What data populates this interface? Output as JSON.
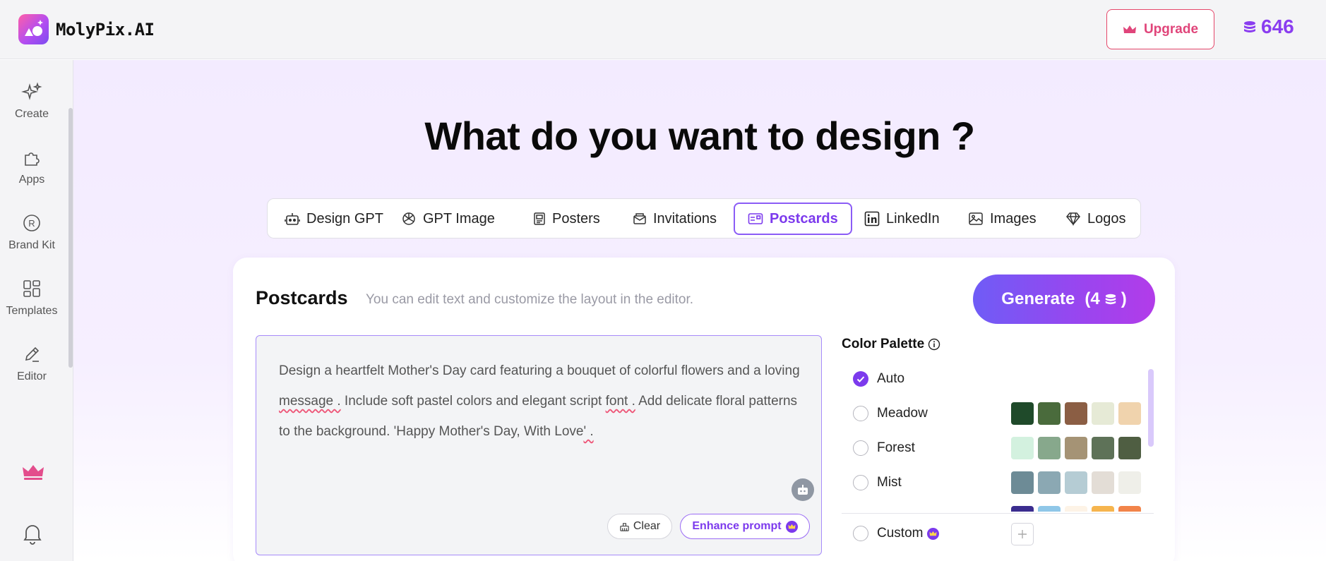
{
  "app": {
    "name": "MolyPix.AI"
  },
  "header": {
    "upgrade_label": "Upgrade",
    "credits": "646"
  },
  "sidebar": {
    "items": [
      {
        "label": "Create",
        "icon": "sparkles-icon"
      },
      {
        "label": "Apps",
        "icon": "puzzle-icon"
      },
      {
        "label": "Brand Kit",
        "icon": "registered-icon"
      },
      {
        "label": "Templates",
        "icon": "grid-icon"
      },
      {
        "label": "Editor",
        "icon": "pencil-icon"
      }
    ],
    "bottom": [
      {
        "icon": "crown-icon"
      },
      {
        "icon": "bell-icon"
      }
    ]
  },
  "main": {
    "headline": "What do you want to design ?",
    "tabs": [
      {
        "label": "Design GPT",
        "icon": "robot-icon"
      },
      {
        "label": "GPT Image",
        "icon": "openai-icon"
      },
      {
        "label": "Posters",
        "icon": "poster-icon"
      },
      {
        "label": "Invitations",
        "icon": "envelope-icon"
      },
      {
        "label": "Postcards",
        "icon": "postcard-icon",
        "active": true
      },
      {
        "label": "LinkedIn",
        "icon": "linkedin-icon"
      },
      {
        "label": "Images",
        "icon": "image-icon"
      },
      {
        "label": "Logos",
        "icon": "diamond-icon"
      }
    ]
  },
  "card": {
    "title": "Postcards",
    "subtitle": "You can edit text and customize the layout in the editor.",
    "generate_label": "Generate",
    "generate_cost": "(4",
    "generate_cost_close": ")",
    "prompt": {
      "part1": "Design a heartfelt Mother's Day card featuring a bouquet of colorful flowers and a loving ",
      "w1": "message .",
      "part2": " Include soft pastel colors and elegant script ",
      "w2": "font .",
      "part3": " Add delicate floral patterns to the background. 'Happy Mother's Day, With Love",
      "w3": "' ."
    },
    "clear_label": "Clear",
    "enhance_label": "Enhance prompt"
  },
  "palette": {
    "title": "Color Palette",
    "options": [
      {
        "name": "Auto",
        "checked": true,
        "colors": []
      },
      {
        "name": "Meadow",
        "checked": false,
        "colors": [
          "#1f4a2a",
          "#4a6b3c",
          "#8b5e44",
          "#e6ead6",
          "#f0d3ad"
        ]
      },
      {
        "name": "Forest",
        "checked": false,
        "colors": [
          "#d3f1df",
          "#87a88c",
          "#a59375",
          "#5e7258",
          "#4f5e42"
        ]
      },
      {
        "name": "Mist",
        "checked": false,
        "colors": [
          "#6d8b96",
          "#8ba8b3",
          "#b5ccd4",
          "#e3ddd6",
          "#efefe9"
        ]
      },
      {
        "name": "",
        "checked": false,
        "colors": [
          "#3b2d8f",
          "#8fc7e8",
          "#fdf3e6",
          "#f6b54e",
          "#f2844a"
        ]
      }
    ],
    "custom_label": "Custom"
  },
  "colors": {
    "accent": "#7c3aed",
    "upgrade": "#e0457a"
  }
}
